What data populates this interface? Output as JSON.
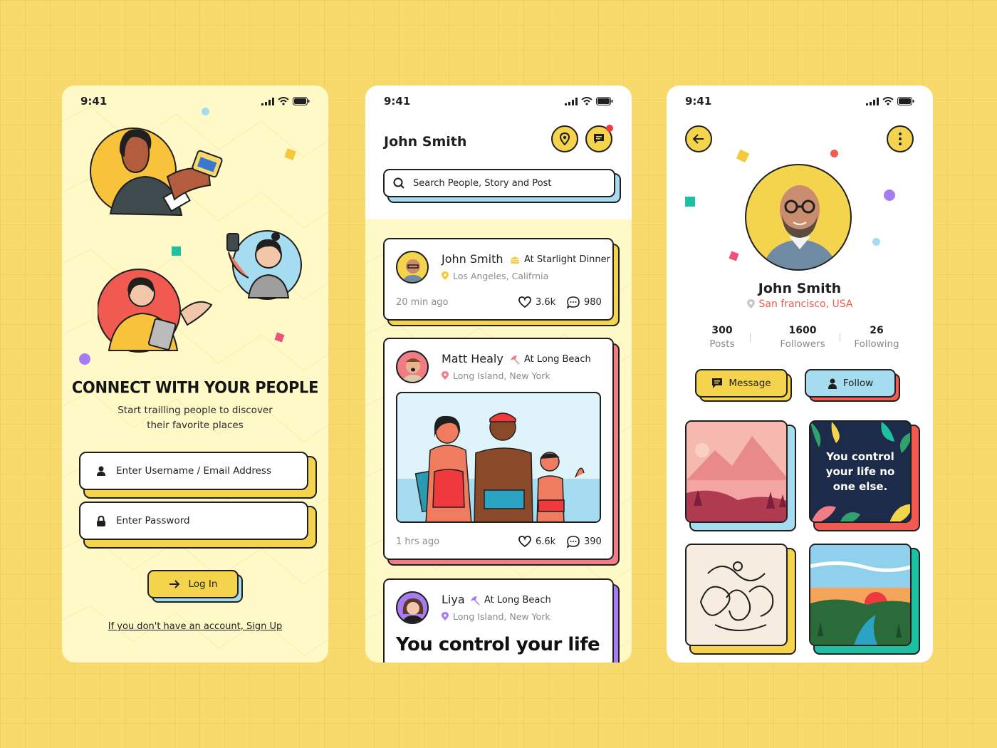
{
  "status": {
    "time": "9:41"
  },
  "login": {
    "title": "CONNECT WITH YOUR PEOPLE",
    "subtitle": "Start trailling people to discover their favorite places",
    "username_placeholder": "Enter Username / Email Address",
    "password_placeholder": "Enter Password",
    "login_button": "Log In",
    "signup_link": "If you don't have an account, Sign Up"
  },
  "feed": {
    "title": "John Smith",
    "search_placeholder": "Search People, Story and Post",
    "posts": [
      {
        "name": "John Smith",
        "place": "At Starlight Dinner",
        "location": "Los Angeles, Califrnia",
        "time": "20 min ago",
        "likes": "3.6k",
        "comments": "980"
      },
      {
        "name": "Matt Healy",
        "place": "At Long Beach",
        "location": "Long Island, New York",
        "time": "1 hrs ago",
        "likes": "6.6k",
        "comments": "390"
      },
      {
        "name": "Liya",
        "place": "At Long Beach",
        "location": "Long Island, New York",
        "quote": "You control your life"
      }
    ]
  },
  "profile": {
    "name": "John Smith",
    "location": "San francisco, USA",
    "stats": [
      {
        "value": "300",
        "label": "Posts"
      },
      {
        "value": "1600",
        "label": "Followers"
      },
      {
        "value": "26",
        "label": "Following"
      }
    ],
    "message_button": "Message",
    "follow_button": "Follow",
    "tile_quote": "You control your life no one else."
  },
  "colors": {
    "background": "#f8d96c",
    "yellow": "#f5d44d",
    "blue": "#a5dcef",
    "pink": "#f07c86",
    "red": "#f05a50",
    "teal": "#1ec0a4",
    "purple": "#a77cf0",
    "ink": "#1f1f1f"
  },
  "icons": [
    "signal-icon",
    "wifi-icon",
    "battery-icon",
    "user-icon",
    "lock-icon",
    "arrow-right-icon",
    "location-pin-icon",
    "chat-icon",
    "search-icon",
    "burger-icon",
    "umbrella-icon",
    "heart-icon",
    "comment-icon",
    "back-arrow-icon",
    "more-vertical-icon",
    "message-icon",
    "person-icon"
  ]
}
